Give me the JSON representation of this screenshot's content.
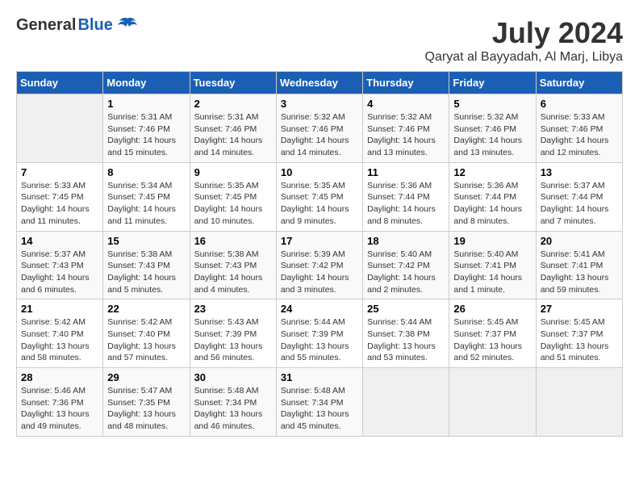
{
  "logo": {
    "general": "General",
    "blue": "Blue"
  },
  "title": "July 2024",
  "location": "Qaryat al Bayyadah, Al Marj, Libya",
  "weekdays": [
    "Sunday",
    "Monday",
    "Tuesday",
    "Wednesday",
    "Thursday",
    "Friday",
    "Saturday"
  ],
  "weeks": [
    [
      {
        "day": "",
        "info": ""
      },
      {
        "day": "1",
        "info": "Sunrise: 5:31 AM\nSunset: 7:46 PM\nDaylight: 14 hours\nand 15 minutes."
      },
      {
        "day": "2",
        "info": "Sunrise: 5:31 AM\nSunset: 7:46 PM\nDaylight: 14 hours\nand 14 minutes."
      },
      {
        "day": "3",
        "info": "Sunrise: 5:32 AM\nSunset: 7:46 PM\nDaylight: 14 hours\nand 14 minutes."
      },
      {
        "day": "4",
        "info": "Sunrise: 5:32 AM\nSunset: 7:46 PM\nDaylight: 14 hours\nand 13 minutes."
      },
      {
        "day": "5",
        "info": "Sunrise: 5:32 AM\nSunset: 7:46 PM\nDaylight: 14 hours\nand 13 minutes."
      },
      {
        "day": "6",
        "info": "Sunrise: 5:33 AM\nSunset: 7:46 PM\nDaylight: 14 hours\nand 12 minutes."
      }
    ],
    [
      {
        "day": "7",
        "info": "Sunrise: 5:33 AM\nSunset: 7:45 PM\nDaylight: 14 hours\nand 11 minutes."
      },
      {
        "day": "8",
        "info": "Sunrise: 5:34 AM\nSunset: 7:45 PM\nDaylight: 14 hours\nand 11 minutes."
      },
      {
        "day": "9",
        "info": "Sunrise: 5:35 AM\nSunset: 7:45 PM\nDaylight: 14 hours\nand 10 minutes."
      },
      {
        "day": "10",
        "info": "Sunrise: 5:35 AM\nSunset: 7:45 PM\nDaylight: 14 hours\nand 9 minutes."
      },
      {
        "day": "11",
        "info": "Sunrise: 5:36 AM\nSunset: 7:44 PM\nDaylight: 14 hours\nand 8 minutes."
      },
      {
        "day": "12",
        "info": "Sunrise: 5:36 AM\nSunset: 7:44 PM\nDaylight: 14 hours\nand 8 minutes."
      },
      {
        "day": "13",
        "info": "Sunrise: 5:37 AM\nSunset: 7:44 PM\nDaylight: 14 hours\nand 7 minutes."
      }
    ],
    [
      {
        "day": "14",
        "info": "Sunrise: 5:37 AM\nSunset: 7:43 PM\nDaylight: 14 hours\nand 6 minutes."
      },
      {
        "day": "15",
        "info": "Sunrise: 5:38 AM\nSunset: 7:43 PM\nDaylight: 14 hours\nand 5 minutes."
      },
      {
        "day": "16",
        "info": "Sunrise: 5:38 AM\nSunset: 7:43 PM\nDaylight: 14 hours\nand 4 minutes."
      },
      {
        "day": "17",
        "info": "Sunrise: 5:39 AM\nSunset: 7:42 PM\nDaylight: 14 hours\nand 3 minutes."
      },
      {
        "day": "18",
        "info": "Sunrise: 5:40 AM\nSunset: 7:42 PM\nDaylight: 14 hours\nand 2 minutes."
      },
      {
        "day": "19",
        "info": "Sunrise: 5:40 AM\nSunset: 7:41 PM\nDaylight: 14 hours\nand 1 minute."
      },
      {
        "day": "20",
        "info": "Sunrise: 5:41 AM\nSunset: 7:41 PM\nDaylight: 13 hours\nand 59 minutes."
      }
    ],
    [
      {
        "day": "21",
        "info": "Sunrise: 5:42 AM\nSunset: 7:40 PM\nDaylight: 13 hours\nand 58 minutes."
      },
      {
        "day": "22",
        "info": "Sunrise: 5:42 AM\nSunset: 7:40 PM\nDaylight: 13 hours\nand 57 minutes."
      },
      {
        "day": "23",
        "info": "Sunrise: 5:43 AM\nSunset: 7:39 PM\nDaylight: 13 hours\nand 56 minutes."
      },
      {
        "day": "24",
        "info": "Sunrise: 5:44 AM\nSunset: 7:39 PM\nDaylight: 13 hours\nand 55 minutes."
      },
      {
        "day": "25",
        "info": "Sunrise: 5:44 AM\nSunset: 7:38 PM\nDaylight: 13 hours\nand 53 minutes."
      },
      {
        "day": "26",
        "info": "Sunrise: 5:45 AM\nSunset: 7:37 PM\nDaylight: 13 hours\nand 52 minutes."
      },
      {
        "day": "27",
        "info": "Sunrise: 5:45 AM\nSunset: 7:37 PM\nDaylight: 13 hours\nand 51 minutes."
      }
    ],
    [
      {
        "day": "28",
        "info": "Sunrise: 5:46 AM\nSunset: 7:36 PM\nDaylight: 13 hours\nand 49 minutes."
      },
      {
        "day": "29",
        "info": "Sunrise: 5:47 AM\nSunset: 7:35 PM\nDaylight: 13 hours\nand 48 minutes."
      },
      {
        "day": "30",
        "info": "Sunrise: 5:48 AM\nSunset: 7:34 PM\nDaylight: 13 hours\nand 46 minutes."
      },
      {
        "day": "31",
        "info": "Sunrise: 5:48 AM\nSunset: 7:34 PM\nDaylight: 13 hours\nand 45 minutes."
      },
      {
        "day": "",
        "info": ""
      },
      {
        "day": "",
        "info": ""
      },
      {
        "day": "",
        "info": ""
      }
    ]
  ]
}
